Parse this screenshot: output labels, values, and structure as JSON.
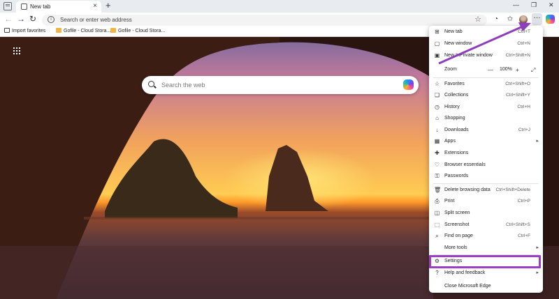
{
  "tab": {
    "title": "New tab",
    "close": "×",
    "new_tab": "+"
  },
  "window": {
    "minimize": "—",
    "restore": "❐",
    "close": "✕"
  },
  "toolbar": {
    "back": "←",
    "forward": "→",
    "refresh": "↻",
    "address_placeholder": "Search or enter web address",
    "favorite_star": "☆",
    "more": "···"
  },
  "favorites_bar": {
    "items": [
      {
        "label": "Import favorites",
        "icon": "folder-icon"
      },
      {
        "label": "Gofile - Cloud Stora...",
        "icon": "gofile-icon"
      },
      {
        "label": "Gofile - Cloud Stora...",
        "icon": "gofile-icon"
      }
    ]
  },
  "search": {
    "placeholder": "Search the web"
  },
  "menu": {
    "items": [
      {
        "label": "New tab",
        "shortcut": "Ctrl+T",
        "icon": "new-tab-icon"
      },
      {
        "label": "New window",
        "shortcut": "Ctrl+N",
        "icon": "new-window-icon"
      },
      {
        "label": "New InPrivate window",
        "shortcut": "Ctrl+Shift+N",
        "icon": "inprivate-icon"
      },
      {
        "label": "Zoom",
        "zoom_value": "100%",
        "minus": "—",
        "plus": "+",
        "fullscreen": "⤢"
      },
      {
        "label": "Favorites",
        "shortcut": "Ctrl+Shift+O",
        "icon": "favorites-icon"
      },
      {
        "label": "Collections",
        "shortcut": "Ctrl+Shift+Y",
        "icon": "collections-icon"
      },
      {
        "label": "History",
        "shortcut": "Ctrl+H",
        "icon": "history-icon"
      },
      {
        "label": "Shopping",
        "shortcut": "",
        "icon": "shopping-icon"
      },
      {
        "label": "Downloads",
        "shortcut": "Ctrl+J",
        "icon": "downloads-icon"
      },
      {
        "label": "Apps",
        "shortcut": "",
        "icon": "apps-icon",
        "submenu": true
      },
      {
        "label": "Extensions",
        "shortcut": "",
        "icon": "extensions-icon"
      },
      {
        "label": "Browser essentials",
        "shortcut": "",
        "icon": "browser-essentials-icon"
      },
      {
        "label": "Passwords",
        "shortcut": "",
        "icon": "passwords-icon"
      },
      {
        "label": "Delete browsing data",
        "shortcut": "Ctrl+Shift+Delete",
        "icon": "delete-icon"
      },
      {
        "label": "Print",
        "shortcut": "Ctrl+P",
        "icon": "print-icon"
      },
      {
        "label": "Split screen",
        "shortcut": "",
        "icon": "split-screen-icon"
      },
      {
        "label": "Screenshot",
        "shortcut": "Ctrl+Shift+S",
        "icon": "screenshot-icon"
      },
      {
        "label": "Find on page",
        "shortcut": "Ctrl+F",
        "icon": "find-icon"
      },
      {
        "label": "More tools",
        "shortcut": "",
        "icon": "",
        "submenu": true
      },
      {
        "label": "Settings",
        "shortcut": "",
        "icon": "settings-icon"
      },
      {
        "label": "Help and feedback",
        "shortcut": "",
        "icon": "help-icon",
        "submenu": true
      },
      {
        "label": "Close Microsoft Edge",
        "shortcut": "",
        "icon": ""
      }
    ]
  },
  "colors": {
    "highlight": "#9b3fc4",
    "menu_bg": "#ffffff",
    "titlebar": "#e8ecf1"
  }
}
